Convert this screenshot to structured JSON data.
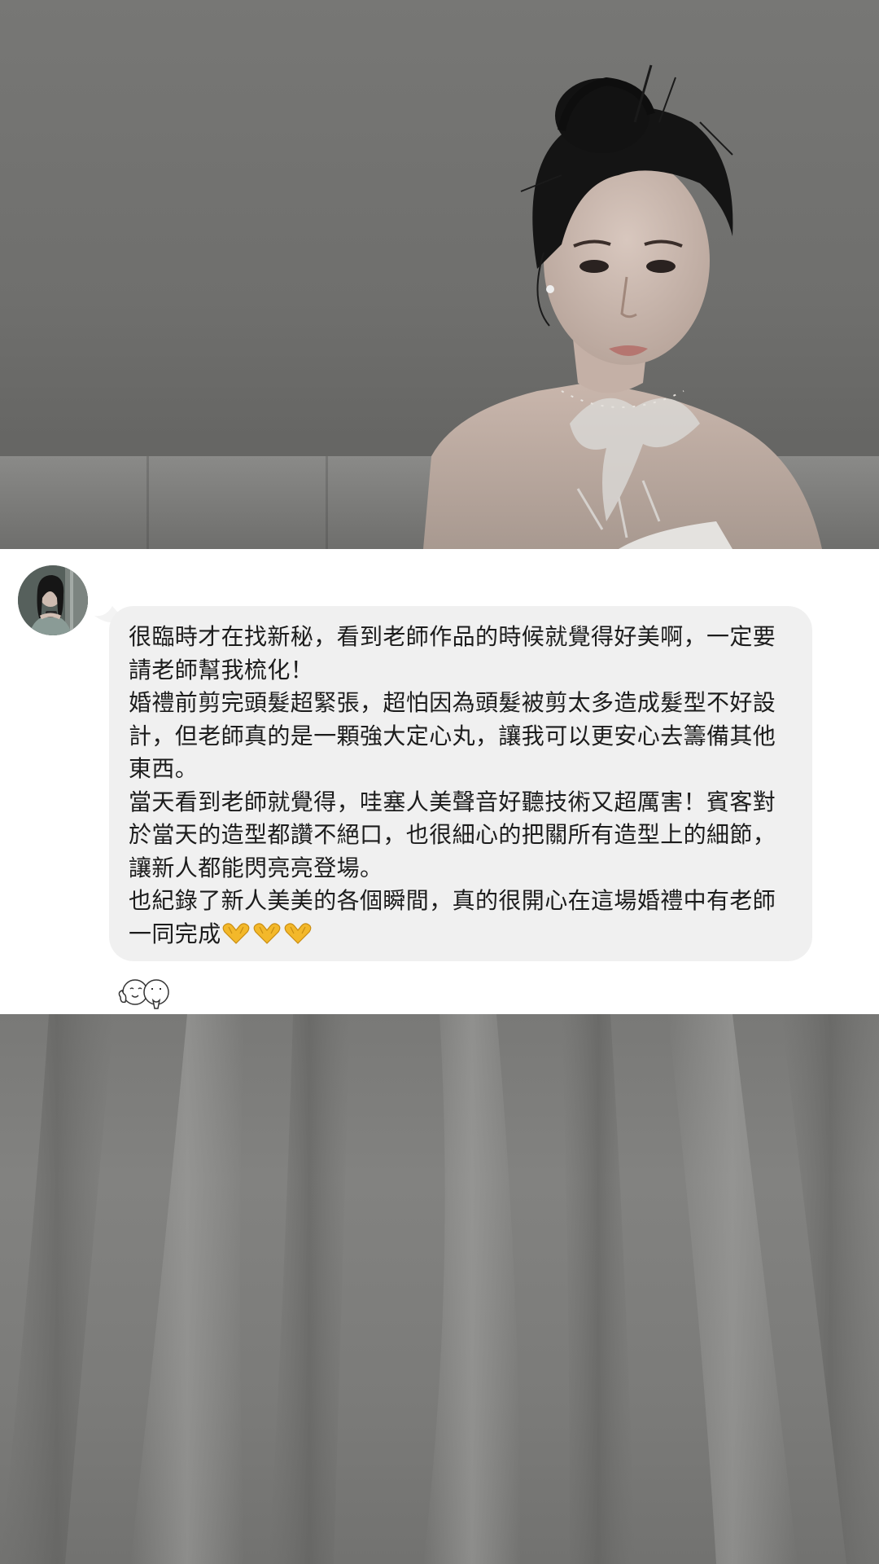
{
  "message": {
    "lines": [
      "很臨時才在找新秘，看到老師作品的時候就覺得好美啊，一定要請老師幫我梳化！",
      "婚禮前剪完頭髮超緊張，超怕因為頭髮被剪太多造成髮型不好設計，但老師真的是一顆強大定心丸，讓我可以更安心去籌備其他東西。",
      "當天看到老師就覺得，哇塞人美聲音好聽技術又超厲害！賓客對於當天的造型都讚不絕口，也很細心的把關所有造型上的細節，讓新人都能閃亮亮登場。",
      "也紀錄了新人美美的各個瞬間，真的很開心在這場婚禮中有老師一同完成"
    ],
    "trailing_emoji_count": 3,
    "trailing_emoji_icon": "heart-hands-icon",
    "reaction_icon": "thumbs-up-couple-sticker-icon"
  },
  "colors": {
    "bubble": "#f0f0f0",
    "card": "#ffffff",
    "photo_tone": "#757573",
    "emoji": "#f3b82a"
  }
}
